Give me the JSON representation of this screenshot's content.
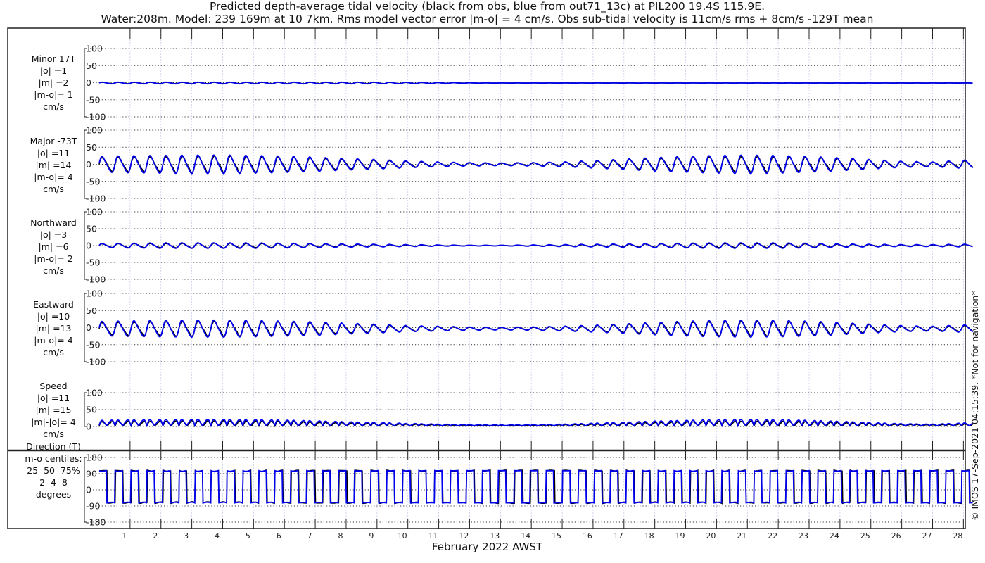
{
  "chart_data": {
    "type": "line",
    "title": "Predicted depth-average tidal velocity (black from obs, blue from out71_13c) at PIL200 19.4S 115.9E.",
    "subtitle": "Water:208m. Model: 239 169m at 10 7km. Rms model vector error |m-o| = 4 cm/s. Obs sub-tidal velocity is 11cm/s rms + 8cm/s -129T mean",
    "xlabel": "February 2022 AWST",
    "x_ticks": [
      1,
      2,
      3,
      4,
      5,
      6,
      7,
      8,
      9,
      10,
      11,
      12,
      13,
      14,
      15,
      16,
      17,
      18,
      19,
      20,
      21,
      22,
      23,
      24,
      25,
      26,
      27,
      28
    ],
    "xlim_days": [
      0,
      28.3
    ],
    "tidal_period_hours": 12.42,
    "series_legend": [
      {
        "name": "obs",
        "color": "#000000"
      },
      {
        "name": "model out71_13c",
        "color": "#0000ee"
      }
    ],
    "copyright": "© IMOS 17-Sep-2021 04:15:39. *Not for navigation*",
    "envelope_days": [
      0,
      1,
      2,
      3,
      4,
      5,
      6,
      7,
      8,
      9,
      10,
      11,
      12,
      13,
      14,
      15,
      16,
      17,
      18,
      19,
      20,
      21,
      22,
      23,
      24,
      25,
      26,
      27,
      28
    ],
    "panels": [
      {
        "id": "minor",
        "labels": [
          "Minor 17T",
          "|o| =1",
          "|m| =2",
          "|m-o|= 1",
          "cm/s"
        ],
        "yticks": [
          "100",
          "50",
          "0",
          "-50",
          "-100"
        ],
        "ylim": [
          -100,
          100
        ],
        "obs_amplitude": [
          2,
          2,
          2,
          2,
          2,
          2,
          2,
          2,
          2,
          2,
          1.5,
          1,
          0.5,
          0.3,
          0.3,
          0.3,
          0.3,
          0.3,
          0.3,
          0.3,
          0.3,
          0.3,
          0.3,
          0.3,
          0.3,
          0.3,
          0.3,
          0.3,
          0.3
        ],
        "model_amplitude": [
          2.5,
          2.5,
          2.5,
          2.5,
          2.5,
          2.5,
          2.5,
          2.5,
          2.5,
          2.5,
          2,
          1.2,
          0.6,
          0.4,
          0.4,
          0.4,
          0.4,
          0.4,
          0.4,
          0.4,
          0.4,
          0.4,
          0.4,
          0.4,
          0.4,
          0.4,
          0.4,
          0.4,
          0.4
        ],
        "mean": -1
      },
      {
        "id": "major",
        "labels": [
          "Major -73T",
          "|o| =11",
          "|m| =14",
          "|m-o|= 4",
          "cm/s"
        ],
        "yticks": [
          "100",
          "50",
          "0",
          "-50",
          "-100"
        ],
        "ylim": [
          -100,
          100
        ],
        "obs_amplitude": [
          20,
          22,
          23,
          24,
          24,
          23,
          21,
          18,
          15,
          12,
          9,
          6,
          4,
          3,
          4,
          6,
          9,
          13,
          17,
          20,
          22,
          23,
          22,
          20,
          16,
          12,
          8,
          6,
          10
        ],
        "model_amplitude": [
          23,
          25,
          26,
          27,
          27,
          26,
          24,
          21,
          17,
          14,
          10,
          7,
          5,
          4,
          5,
          7,
          11,
          15,
          20,
          23,
          26,
          27,
          26,
          23,
          19,
          14,
          9,
          7,
          12
        ],
        "mean": 0
      },
      {
        "id": "northward",
        "labels": [
          "Northward",
          "|o| =3",
          "|m| =6",
          "|m-o|= 2",
          "cm/s"
        ],
        "yticks": [
          "100",
          "50",
          "0",
          "-50",
          "-100"
        ],
        "ylim": [
          -100,
          100
        ],
        "obs_amplitude": [
          5,
          6,
          6,
          7,
          7,
          6,
          6,
          5,
          4,
          3,
          2,
          1.5,
          1,
          1,
          1.5,
          2,
          3,
          4,
          5,
          6,
          6,
          6,
          6,
          5,
          4,
          3,
          2.5,
          2,
          3
        ],
        "model_amplitude": [
          6,
          7,
          8,
          8,
          8,
          8,
          7,
          6,
          5,
          4,
          3,
          2,
          1,
          1,
          2,
          3,
          4,
          5,
          6,
          7,
          8,
          8,
          8,
          7,
          5,
          4,
          3,
          3,
          4
        ],
        "mean": 0
      },
      {
        "id": "eastward",
        "labels": [
          "Eastward",
          "|o| =10",
          "|m| =13",
          "|m-o|= 4",
          "cm/s"
        ],
        "yticks": [
          "100",
          "50",
          "0",
          "-50",
          "-100"
        ],
        "ylim": [
          -100,
          100
        ],
        "obs_amplitude": [
          18,
          20,
          21,
          22,
          22,
          21,
          19,
          17,
          14,
          11,
          8,
          6,
          4,
          3,
          4,
          6,
          9,
          12,
          16,
          19,
          21,
          22,
          21,
          19,
          15,
          11,
          8,
          6,
          9
        ],
        "model_amplitude": [
          21,
          23,
          24,
          25,
          25,
          24,
          22,
          20,
          16,
          13,
          9,
          7,
          5,
          4,
          5,
          7,
          10,
          14,
          18,
          22,
          24,
          25,
          24,
          22,
          18,
          13,
          9,
          7,
          11
        ],
        "mean": -3
      },
      {
        "id": "speed",
        "labels": [
          "Speed",
          "|o| =11",
          "|m| =15",
          "|m|-|o|= 4",
          "cm/s"
        ],
        "yticks": [
          "100",
          "50",
          "0"
        ],
        "ylim": [
          0,
          100
        ]
      },
      {
        "id": "direction",
        "labels": [
          "Direction (T)",
          "m-o centiles:",
          "25  50  75%",
          "2  4  8",
          "degrees"
        ],
        "yticks": [
          "180",
          "90",
          "0",
          "-90",
          "-180"
        ],
        "ylim": [
          -180,
          180
        ],
        "flood_direction": 107,
        "ebb_direction": -73
      }
    ]
  }
}
